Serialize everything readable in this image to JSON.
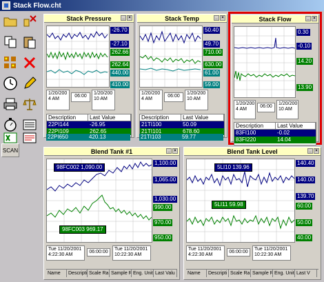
{
  "window": {
    "title": "Stack Flow.cht"
  },
  "toolbar": {
    "scan_label": "SCAN"
  },
  "panels": {
    "stack_pressure": {
      "title": "Stack Pressure",
      "scale": [
        "-26.70",
        "-27.10",
        "262.66",
        "262.64",
        "440.00",
        "410.00"
      ],
      "time_left_date": "1/20/200",
      "time_left_time": "4 AM",
      "time_mid": "06:00",
      "time_right_date": "1/20/200",
      "time_right_time": "10 AM",
      "table_head": [
        "Description",
        "Last Value"
      ],
      "rows": [
        {
          "desc": "22PI144",
          "value": "-26.95",
          "color": "#000080"
        },
        {
          "desc": "22PI109",
          "value": "262.65",
          "color": "#008000"
        },
        {
          "desc": "22PI650",
          "value": "420.13",
          "color": "#008080"
        }
      ]
    },
    "stack_temp": {
      "title": "Stack Temp",
      "scale": [
        "50.40",
        "49.70",
        "710.00",
        "630.00",
        "61.00",
        "59.00"
      ],
      "time_left_date": "1/20/200",
      "time_left_time": "4 AM",
      "time_mid": "06:00",
      "time_right_date": "1/20/200",
      "time_right_time": "10 AM",
      "table_head": [
        "Description",
        "Last Value"
      ],
      "rows": [
        {
          "desc": "21TI100",
          "value": "50.09",
          "color": "#000080"
        },
        {
          "desc": "21TI101",
          "value": "678.60",
          "color": "#008000"
        },
        {
          "desc": "21TI103",
          "value": "59.77",
          "color": "#008080"
        }
      ]
    },
    "stack_flow": {
      "title": "Stack Flow",
      "scale": [
        "0.30",
        "-0.10",
        "14.20",
        "13.90"
      ],
      "time_left_date": "1/20/200",
      "time_left_time": "4 AM",
      "time_mid": "06:00",
      "time_right_date": "1/20/200",
      "time_right_time": "10 AM",
      "table_head": [
        "Description",
        "Last Value"
      ],
      "rows": [
        {
          "desc": "83FI100",
          "value": "-0.02",
          "color": "#000080"
        },
        {
          "desc": "83FI220",
          "value": "14.04",
          "color": "#008000"
        }
      ]
    },
    "blend_tank_1": {
      "title": "Blend Tank #1",
      "scale": [
        "1,100.00",
        "1,065.00",
        "1,030.00",
        "990.00",
        "970.00",
        "950.00"
      ],
      "overlay_top": "98FC002 1,090.00",
      "overlay_bottom": "98FC003 969.17",
      "time_left_date": "Tue 11/20/2001",
      "time_left_time": "4:22:30 AM",
      "time_mid": "06:00:00",
      "time_right_date": "Tue 11/20/2001",
      "time_right_time": "10:22:30 AM",
      "columns": [
        "Name",
        "Descripti",
        "Scale Ra",
        "Sample R",
        "Eng. Unit",
        "Last Valu"
      ]
    },
    "blend_tank_level": {
      "title": "Blend Tank Level",
      "scale": [
        "140.40",
        "140.00",
        "139.70",
        "60.00",
        "50.00",
        "40.00"
      ],
      "overlay_top": "5LI10 139.96",
      "overlay_bottom": "5LI11 59.98",
      "time_left_date": "Tue 11/20/2001",
      "time_left_time": "4:22:30 AM",
      "time_mid": "06:00:00",
      "time_right_date": "Tue 11/20/2001",
      "time_right_time": "10:22:30 AM",
      "columns": [
        "Name",
        "Descripti",
        "Scale Ra",
        "Sample R",
        "Eng. Unit",
        "Last V"
      ]
    }
  },
  "colors": {
    "navy": "#000080",
    "green": "#008000",
    "teal": "#008080",
    "highlight": "#e00000",
    "title_bg": "#ffffc0"
  }
}
